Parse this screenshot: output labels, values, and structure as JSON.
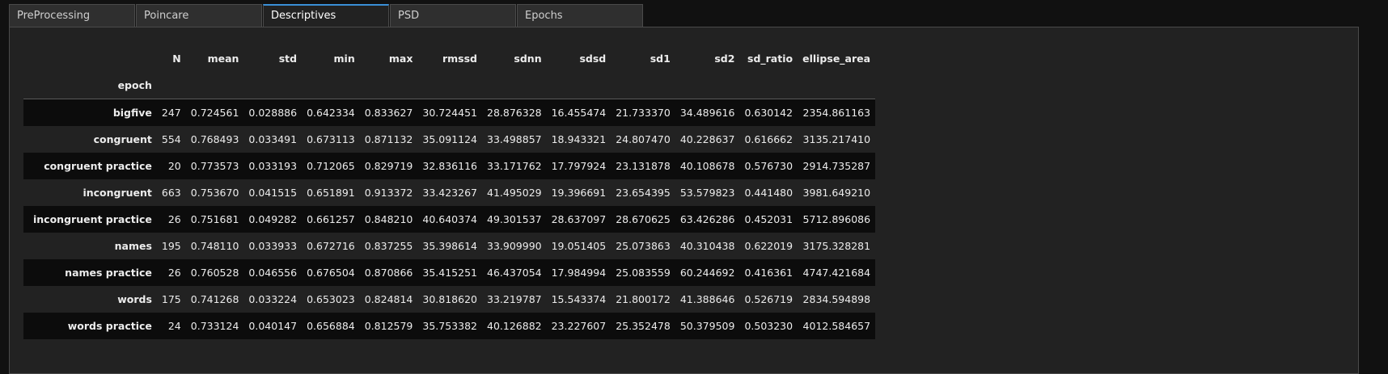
{
  "tabs": [
    {
      "label": "PreProcessing",
      "active": false
    },
    {
      "label": "Poincare",
      "active": false
    },
    {
      "label": "Descriptives",
      "active": true
    },
    {
      "label": "PSD",
      "active": false
    },
    {
      "label": "Epochs",
      "active": false
    }
  ],
  "table": {
    "index_name": "epoch",
    "columns": [
      "N",
      "mean",
      "std",
      "min",
      "max",
      "rmssd",
      "sdnn",
      "sdsd",
      "sd1",
      "sd2",
      "sd_ratio",
      "ellipse_area"
    ],
    "rows": [
      {
        "epoch": "bigfive",
        "cells": [
          "247",
          "0.724561",
          "0.028886",
          "0.642334",
          "0.833627",
          "30.724451",
          "28.876328",
          "16.455474",
          "21.733370",
          "34.489616",
          "0.630142",
          "2354.861163"
        ]
      },
      {
        "epoch": "congruent",
        "cells": [
          "554",
          "0.768493",
          "0.033491",
          "0.673113",
          "0.871132",
          "35.091124",
          "33.498857",
          "18.943321",
          "24.807470",
          "40.228637",
          "0.616662",
          "3135.217410"
        ]
      },
      {
        "epoch": "congruent practice",
        "cells": [
          "20",
          "0.773573",
          "0.033193",
          "0.712065",
          "0.829719",
          "32.836116",
          "33.171762",
          "17.797924",
          "23.131878",
          "40.108678",
          "0.576730",
          "2914.735287"
        ]
      },
      {
        "epoch": "incongruent",
        "cells": [
          "663",
          "0.753670",
          "0.041515",
          "0.651891",
          "0.913372",
          "33.423267",
          "41.495029",
          "19.396691",
          "23.654395",
          "53.579823",
          "0.441480",
          "3981.649210"
        ]
      },
      {
        "epoch": "incongruent practice",
        "cells": [
          "26",
          "0.751681",
          "0.049282",
          "0.661257",
          "0.848210",
          "40.640374",
          "49.301537",
          "28.637097",
          "28.670625",
          "63.426286",
          "0.452031",
          "5712.896086"
        ]
      },
      {
        "epoch": "names",
        "cells": [
          "195",
          "0.748110",
          "0.033933",
          "0.672716",
          "0.837255",
          "35.398614",
          "33.909990",
          "19.051405",
          "25.073863",
          "40.310438",
          "0.622019",
          "3175.328281"
        ]
      },
      {
        "epoch": "names practice",
        "cells": [
          "26",
          "0.760528",
          "0.046556",
          "0.676504",
          "0.870866",
          "35.415251",
          "46.437054",
          "17.984994",
          "25.083559",
          "60.244692",
          "0.416361",
          "4747.421684"
        ]
      },
      {
        "epoch": "words",
        "cells": [
          "175",
          "0.741268",
          "0.033224",
          "0.653023",
          "0.824814",
          "30.818620",
          "33.219787",
          "15.543374",
          "21.800172",
          "41.388646",
          "0.526719",
          "2834.594898"
        ]
      },
      {
        "epoch": "words practice",
        "cells": [
          "24",
          "0.733124",
          "0.040147",
          "0.656884",
          "0.812579",
          "35.753382",
          "40.126882",
          "23.227607",
          "25.352478",
          "50.379509",
          "0.503230",
          "4012.584657"
        ]
      }
    ]
  }
}
